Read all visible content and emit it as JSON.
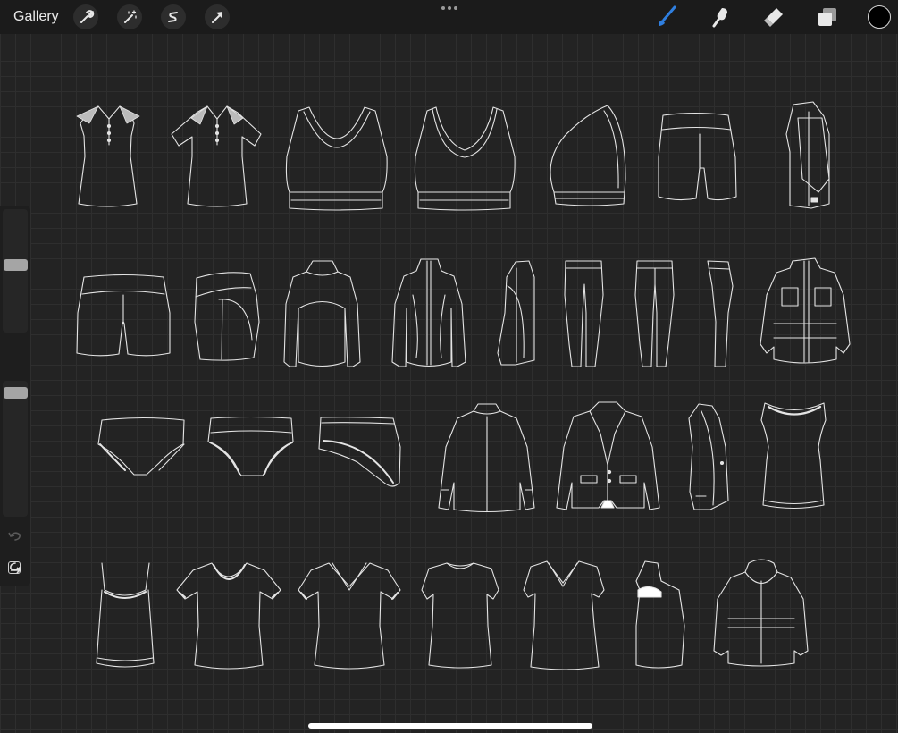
{
  "toolbar": {
    "gallery_label": "Gallery",
    "left_tools": [
      "wrench-icon",
      "magic-wand-icon",
      "selection-s-icon",
      "transform-arrow-icon"
    ],
    "right_tools": [
      "brush-icon",
      "smudge-icon",
      "eraser-icon",
      "layers-icon"
    ],
    "active_tool": "brush",
    "accent_color": "#2f7fe0",
    "current_color": "#000000"
  },
  "sidebar": {
    "brush_size_level": 0.55,
    "opacity_level": 0.95,
    "controls": [
      "modify-button",
      "undo-icon",
      "redo-icon"
    ]
  },
  "canvas": {
    "background": "#232323",
    "grid_color": "#2e2e2e",
    "stroke_color": "#e4e4e4",
    "rows": [
      [
        "sleeveless-polo",
        "short-sleeve-polo",
        "racerback-sports-bra-back",
        "racerback-sports-bra-front",
        "sports-bra-side",
        "shorts-back",
        "hooded-jacket-side"
      ],
      [
        "short-shorts-front",
        "shorts-side",
        "jacket-back",
        "zip-jacket-front",
        "jacket-side",
        "leggings-front",
        "leggings-back",
        "leggings-side",
        "utility-jacket-front"
      ],
      [
        "brief-back",
        "brief-front",
        "brief-side",
        "blazer-back",
        "blazer-front",
        "blazer-side",
        "tank-top-front"
      ],
      [
        "camisole-front",
        "scoop-neck-tee-front",
        "v-neck-tee-front",
        "tee-back",
        "v-neck-tee-plain",
        "tee-side",
        "hooded-jacket-back"
      ]
    ]
  }
}
